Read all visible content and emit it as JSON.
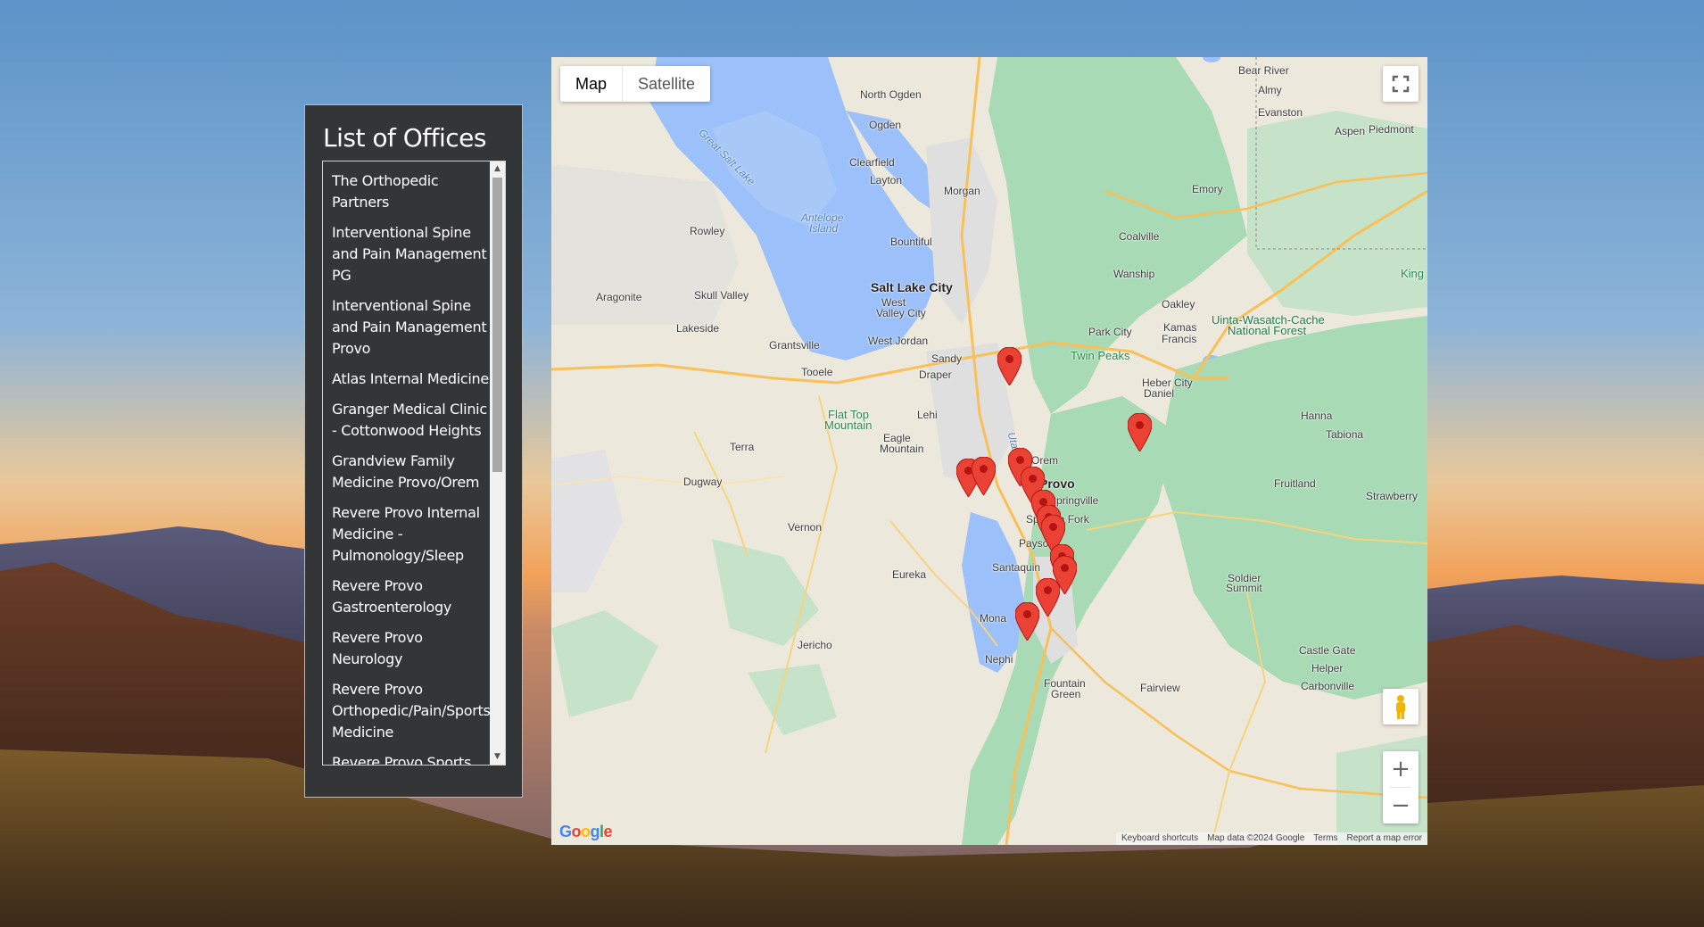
{
  "panel": {
    "title": "List of Offices",
    "offices": [
      {
        "line1": "The Orthopedic",
        "line2": "Partners"
      },
      {
        "line1": "Interventional Spine",
        "line2": "and Pain Management",
        "line3": "PG"
      },
      {
        "line1": "Interventional Spine",
        "line2": "and Pain Management",
        "line3": "Provo"
      },
      {
        "line1": "Atlas Internal Medicine"
      },
      {
        "line1": "Granger Medical Clinic",
        "line2": "- Cottonwood Heights"
      },
      {
        "line1": "Grandview Family",
        "line2": "Medicine Provo/Orem"
      },
      {
        "line1": "Revere Provo Internal",
        "line2": "Medicine -",
        "line3": "Pulmonology/Sleep"
      },
      {
        "line1": "Revere Provo",
        "line2": "Gastroenterology"
      },
      {
        "line1": "Revere Provo",
        "line2": "Neurology"
      },
      {
        "line1": "Revere Provo",
        "line2": "Orthopedic/Pain/Sports",
        "line3": "Medicine"
      },
      {
        "line1": "Revere Provo Sports"
      }
    ]
  },
  "map": {
    "map_type_buttons": {
      "map": "Map",
      "satellite": "Satellite"
    },
    "selected_type": "Map",
    "zoom_in": "+",
    "zoom_out": "−",
    "logo": "Google",
    "attribution": {
      "shortcuts": "Keyboard shortcuts",
      "data": "Map data ©2024 Google",
      "terms": "Terms",
      "report": "Report a map error"
    },
    "places": {
      "slc": "Salt Lake City",
      "north_ogden": "North Ogden",
      "ogden": "Ogden",
      "clearfield": "Clearfield",
      "layton": "Layton",
      "morgan": "Morgan",
      "bountiful": "Bountiful",
      "rowley": "Rowley",
      "antelope": "Antelope",
      "island": "Island",
      "great_salt_lake": "Great Salt Lake",
      "aragonite": "Aragonite",
      "skull_valley": "Skull Valley",
      "lakeside": "Lakeside",
      "grantsville": "Grantsville",
      "tooele": "Tooele",
      "west_valley": "West",
      "west_valley2": "Valley City",
      "west_jordan": "West Jordan",
      "sandy": "Sandy",
      "draper": "Draper",
      "lehi": "Lehi",
      "eagle_mountain1": "Eagle",
      "eagle_mountain2": "Mountain",
      "utah_lake": "Utah Lake",
      "provo": "Provo",
      "orem": "Orem",
      "springville": "Springville",
      "spanish_fork": "Spanish Fork",
      "payson": "Payson",
      "santaquin": "Santaquin",
      "terra": "Terra",
      "dugway": "Dugway",
      "vernon": "Vernon",
      "eureka": "Eureka",
      "mona": "Mona",
      "jericho": "Jericho",
      "nephi": "Nephi",
      "fountain_green1": "Fountain",
      "fountain_green2": "Green",
      "fairview": "Fairview",
      "flat_top1": "Flat Top",
      "flat_top2": "Mountain",
      "twin_peaks": "Twin Peaks",
      "park_city": "Park City",
      "kamas": "Kamas",
      "francis": "Francis",
      "oakley": "Oakley",
      "wanship": "Wanship",
      "coalville": "Coalville",
      "emory": "Emory",
      "heber": "Heber City",
      "daniel": "Daniel",
      "hanna": "Hanna",
      "tabiona": "Tabiona",
      "fruitland": "Fruitland",
      "strawberry": "Strawberry",
      "soldier1": "Soldier",
      "soldier2": "Summit",
      "castle_gate": "Castle Gate",
      "helper": "Helper",
      "carbonville": "Carbonville",
      "bear_river": "Bear River",
      "almy": "Almy",
      "evanston": "Evanston",
      "aspen": "Aspen",
      "piedmont": "Piedmont",
      "uinta1": "Uinta-Wasatch-Cache",
      "uinta2": "National Forest",
      "king": "King"
    },
    "marker_color": "#ea4335"
  },
  "colors": {
    "panel_bg": "#333536",
    "water": "#9cc0f9",
    "park": "#a8dab5",
    "land": "#ede8dc"
  }
}
